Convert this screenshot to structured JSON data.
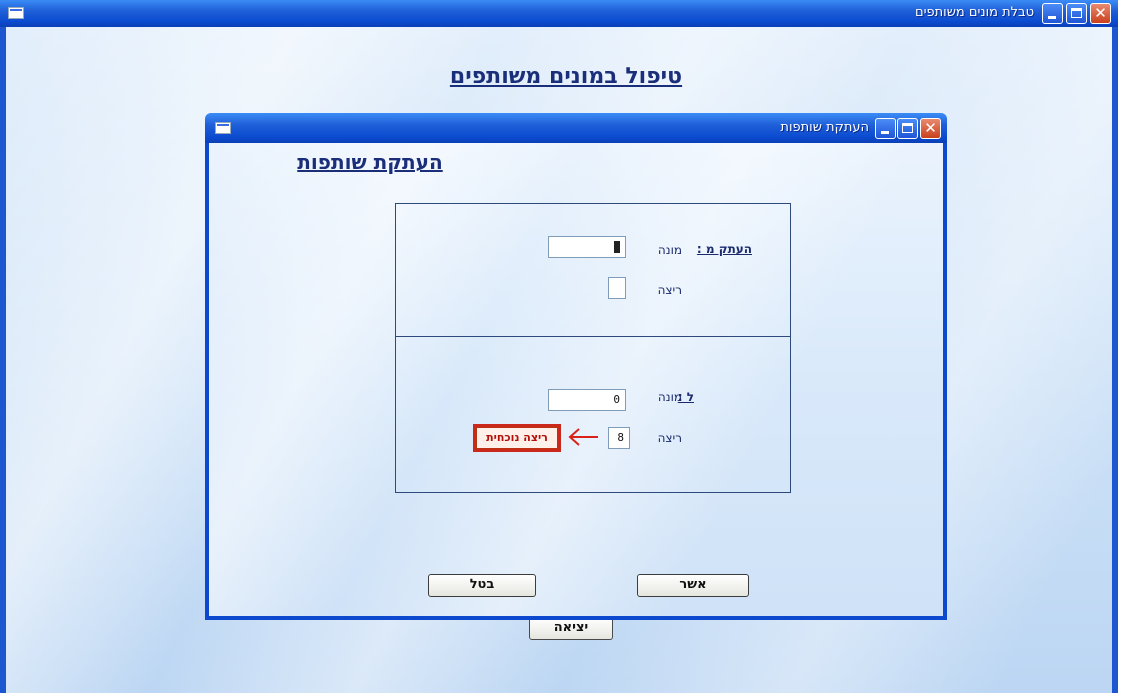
{
  "outer_window": {
    "title": "טבלת מונים משותפים",
    "heading": "טיפול במונים משותפים",
    "exit_label": "יציאה"
  },
  "dialog": {
    "title": "העתקת שותפות",
    "heading": "העתקת שותפות",
    "copy_from": {
      "label": "העתק מ :",
      "counter_label": "מונה",
      "counter_value": "",
      "row_label": "ריצה",
      "row_value": ""
    },
    "copy_to": {
      "label": "ל :",
      "counter_label": "מונה",
      "counter_value": "0",
      "row_label": "ריצה",
      "row_value": "8"
    },
    "current_row_badge": "ריצה נוכחית",
    "confirm_label": "אשר",
    "cancel_label": "בטל"
  },
  "colors": {
    "title_bar": "#0b4bd0",
    "heading_text": "#1a2e7a",
    "badge_red": "#c9281a",
    "arrow_red": "#d8221a"
  },
  "icons": [
    "window-icon",
    "minimize-icon",
    "maximize-icon",
    "close-icon",
    "arrow-left-icon"
  ]
}
